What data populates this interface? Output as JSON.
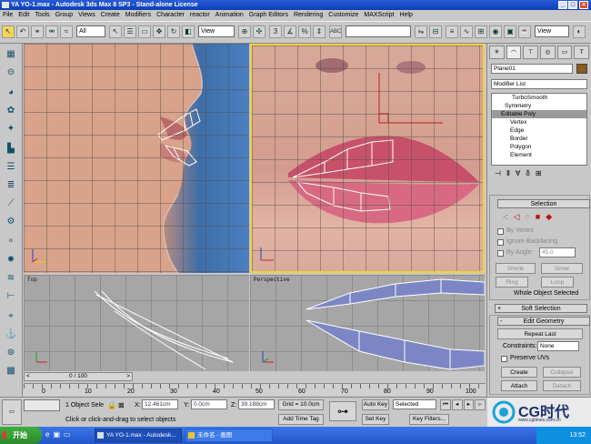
{
  "window": {
    "title": "YA YO-1.max - Autodesk 3ds Max 8 SP3 - Stand-alone License"
  },
  "menu": [
    "File",
    "Edit",
    "Tools",
    "Group",
    "Views",
    "Create",
    "Modifiers",
    "Character",
    "reactor",
    "Animation",
    "Graph Editors",
    "Rendering",
    "Customize",
    "MAXScript",
    "Help"
  ],
  "toolbar": {
    "selection_filter": "All",
    "ref_coord": "View",
    "named_selection": "",
    "view_right": "View"
  },
  "viewports": {
    "top_left": {
      "label": ""
    },
    "top_right": {
      "label": ""
    },
    "bottom_left": {
      "label": "Top"
    },
    "bottom_right": {
      "label": "Perspective"
    }
  },
  "command_panel": {
    "object_name": "Plane01",
    "object_color": "#8a5a1e",
    "modifier_list": "Modifier List",
    "stack": [
      {
        "label": "TurboSmooth"
      },
      {
        "label": "Symmetry"
      },
      {
        "label": "Editable Poly"
      },
      {
        "label": "Vertex"
      },
      {
        "label": "Edge"
      },
      {
        "label": "Border"
      },
      {
        "label": "Polygon"
      },
      {
        "label": "Element"
      }
    ],
    "selection": {
      "title": "Selection",
      "by_vertex": "By Vertex",
      "ignore_backfacing": "Ignore Backfacing",
      "by_angle": "By Angle:",
      "angle_value": "45.0",
      "shrink": "Shrink",
      "grow": "Grow",
      "ring": "Ring",
      "loop": "Loop",
      "status": "Whole Object Selected"
    },
    "soft_selection": {
      "title": "Soft Selection",
      "sign": "+"
    },
    "edit_geometry": {
      "title": "Edit Geometry",
      "sign": "-",
      "repeat_last": "Repeat Last",
      "constraints_label": "Constraints:",
      "constraints_value": "None",
      "preserve_uvs": "Preserve UVs",
      "create": "Create",
      "collapse": "Collapse",
      "attach": "Attach",
      "detach": "Detach"
    }
  },
  "timeline": {
    "frame": "0 / 100",
    "ticks": [
      "0",
      "10",
      "20",
      "30",
      "40",
      "50",
      "60",
      "70",
      "80",
      "90",
      "100"
    ]
  },
  "status": {
    "selection": "1 Object Sele",
    "x_label": "X:",
    "x_value": "12.461cm",
    "y_label": "Y:",
    "y_value": "0.0cm",
    "z_label": "Z:",
    "z_value": "39.188cm",
    "grid": "Grid = 10.0cm",
    "add_time_tag": "Add Time Tag",
    "prompt": "Click or click-and-drag to select objects",
    "auto_key": "Auto Key",
    "selected": "Selected",
    "set_key": "Set Key",
    "key_filters": "Key Filters..."
  },
  "taskbar": {
    "start": "开始",
    "item1": "YA YO-1.max - Autodesk...",
    "item2": "未命名 - 画图",
    "clock": "13:52"
  },
  "watermark": {
    "brand": "CG时代",
    "url": "www.cgtimes.com.cn"
  }
}
